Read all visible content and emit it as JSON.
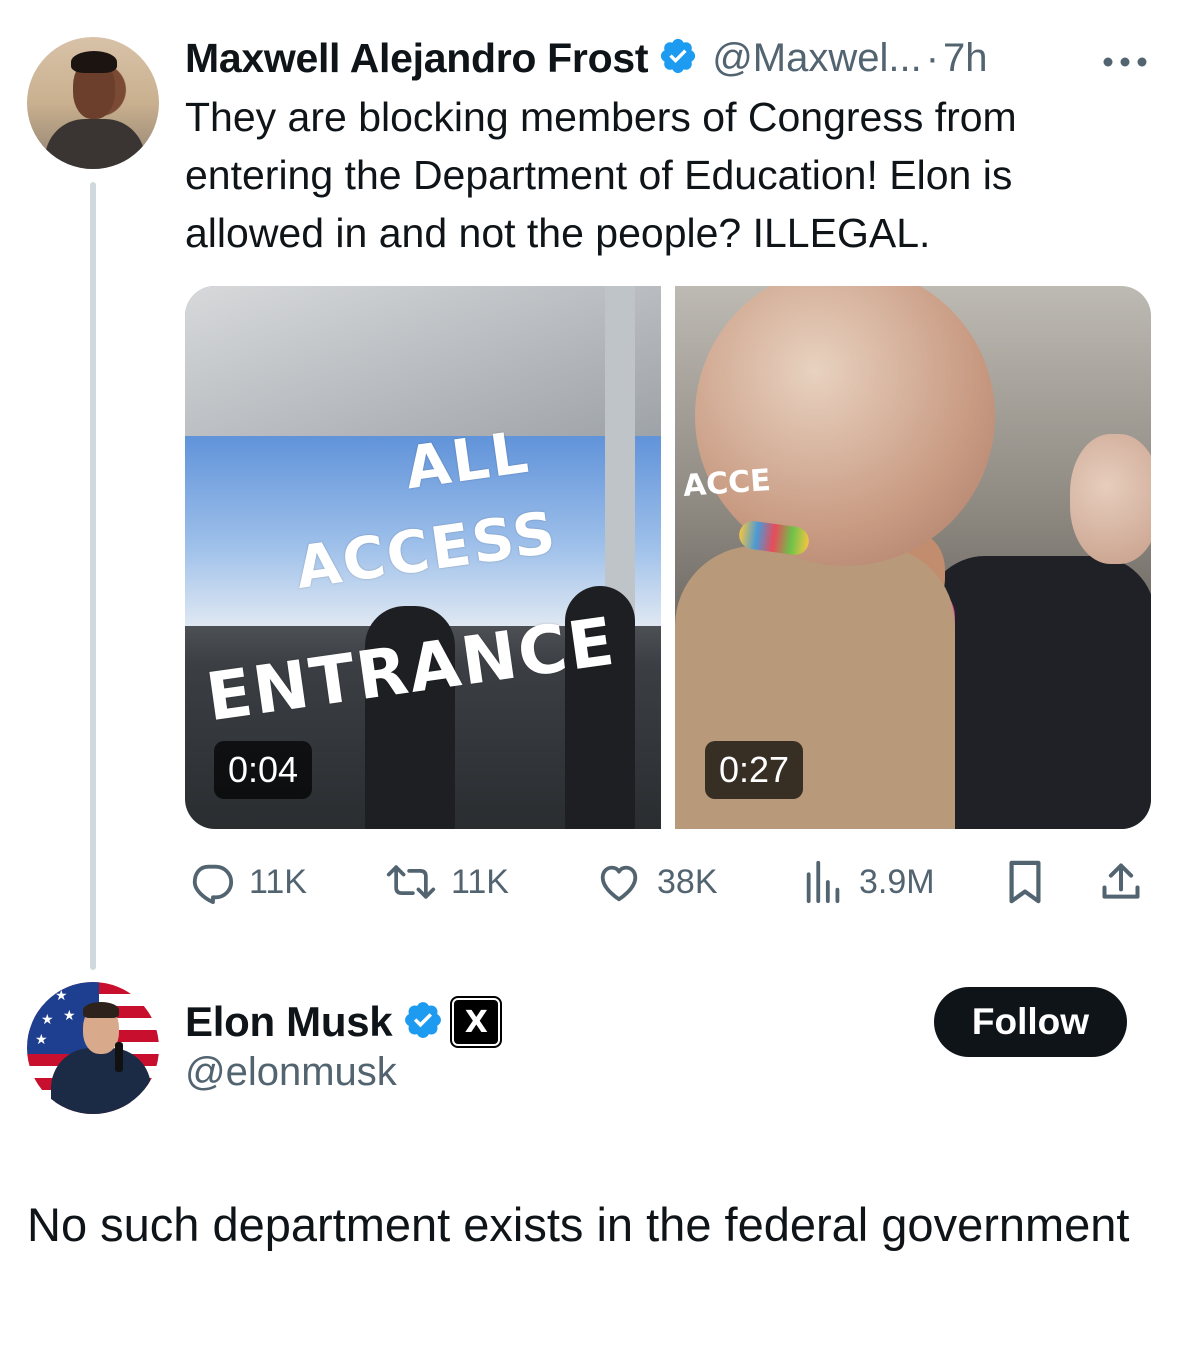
{
  "thread": {
    "first_tweet": {
      "author_name": "Maxwell Alejandro Frost",
      "handle": "@Maxwel...",
      "separator": "·",
      "time": "7h",
      "more_icon": "more-dots-icon",
      "text": "They are blocking members of Congress from entering the Department of Education! Elon is allowed in and not the people? ILLEGAL.",
      "media": [
        {
          "type": "video",
          "duration": "0:04",
          "sign_lines": [
            "ALL",
            "ACCESS",
            "ENTRANCE"
          ]
        },
        {
          "type": "video",
          "duration": "0:27",
          "sign_text": "ACCE"
        }
      ],
      "actions": {
        "replies": "11K",
        "reposts": "11K",
        "likes": "38K",
        "views": "3.9M"
      }
    },
    "second_tweet": {
      "author_name": "Elon Musk",
      "handle": "@elonmusk",
      "badge_letter": "X",
      "follow_label": "Follow",
      "text": "No such department exists in the federal government"
    }
  },
  "colors": {
    "primary_text": "#0f1419",
    "secondary_text": "#536471",
    "verified_blue": "#1d9bf0",
    "thread_line": "#cfd9de",
    "follow_bg": "#0f1419"
  }
}
